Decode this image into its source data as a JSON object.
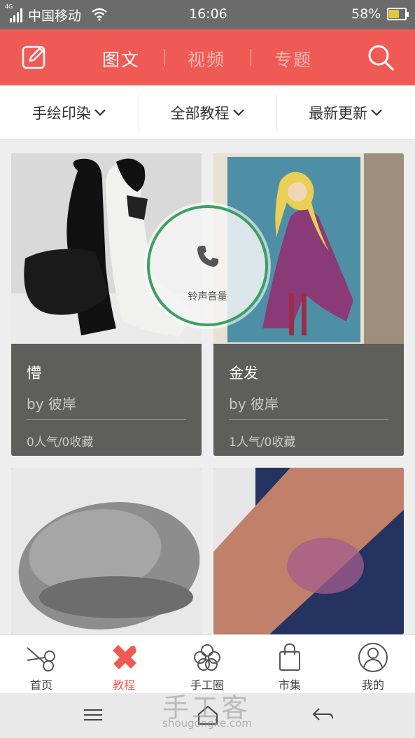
{
  "status_bar": {
    "network": "4G",
    "carrier": "中国移动",
    "time": "16:06",
    "battery": "58%"
  },
  "header": {
    "tabs": [
      {
        "label": "图文",
        "active": true
      },
      {
        "label": "视频",
        "active": false
      },
      {
        "label": "专题",
        "active": false
      }
    ],
    "accent_color": "#f05a54"
  },
  "filters": [
    {
      "label": "手绘印染"
    },
    {
      "label": "全部教程"
    },
    {
      "label": "最新更新"
    }
  ],
  "cards": [
    {
      "title": "懵",
      "author": "by 彼岸",
      "stats": "0人气/0收藏"
    },
    {
      "title": "金发",
      "author": "by 彼岸",
      "stats": "1人气/0收藏"
    },
    {
      "title": "",
      "author": "",
      "stats": ""
    },
    {
      "title": "",
      "author": "",
      "stats": ""
    }
  ],
  "volume_overlay": {
    "label": "铃声音量",
    "icon": "phone-icon"
  },
  "bottom_tabs": [
    {
      "label": "首页",
      "icon": "scissors-icon",
      "active": false
    },
    {
      "label": "教程",
      "icon": "pencil-ruler-icon",
      "active": true
    },
    {
      "label": "手工圈",
      "icon": "flower-icon",
      "active": false
    },
    {
      "label": "市集",
      "icon": "shopping-bag-icon",
      "active": false
    },
    {
      "label": "我的",
      "icon": "profile-icon",
      "active": false
    }
  ],
  "watermark": {
    "text": "手工客",
    "url": "shougongke.com"
  }
}
